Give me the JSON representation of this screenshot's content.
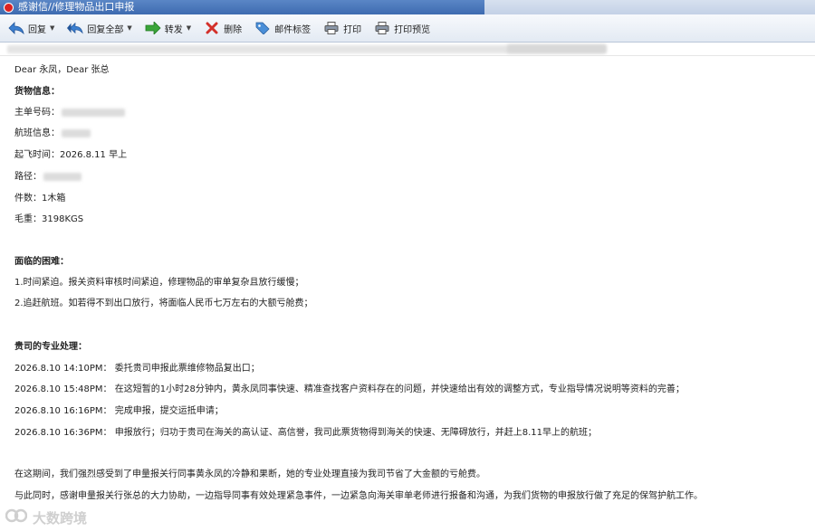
{
  "window": {
    "title": "感谢信//修理物品出口申报"
  },
  "toolbar": {
    "reply": "回复",
    "reply_all": "回复全部",
    "forward": "转发",
    "delete": "删除",
    "tag": "邮件标签",
    "print": "打印",
    "print_preview": "打印预览"
  },
  "email": {
    "greeting": "Dear 永凤，Dear 张总",
    "cargo_heading": "货物信息：",
    "main_no_label": "主单号码：",
    "flight_label": "航班信息：",
    "departure_label": "起飞时间：",
    "departure_value": "2026.8.11 早上",
    "route_label": "路径：",
    "pieces_label": "件数：",
    "pieces_value": "1木箱",
    "weight_label": "毛重：",
    "weight_value": "3198KGS",
    "difficulty_heading": "面临的困难：",
    "difficulties": [
      "1.时间紧迫。报关资料审核时间紧迫，修理物品的审单复杂且放行缓慢；",
      "2.追赶航班。如若得不到出口放行，将面临人民币七万左右的大额亏舱费；"
    ],
    "handling_heading": "贵司的专业处理：",
    "timeline": [
      "2026.8.10 14:10PM：  委托贵司申报此票维修物品复出口；",
      "2026.8.10 15:48PM：  在这短暂的1小时28分钟内，黄永凤同事快速、精准查找客户资料存在的问题，并快速给出有效的调整方式，专业指导情况说明等资料的完善；",
      "2026.8.10 16:16PM：  完成申报，提交运抵申请；",
      "2026.8.10 16:36PM：  申报放行；归功于贵司在海关的高认证、高信誉，我司此票货物得到海关的快速、无障碍放行，并赶上8.11早上的航班；"
    ],
    "closing_1": "在这期间，我们强烈感受到了申量报关行同事黄永凤的冷静和果断，她的专业处理直接为我司节省了大金额的亏舱费。",
    "closing_2": "与此同时，感谢申量报关行张总的大力协助，一边指导同事有效处理紧急事件，一边紧急向海关审单老师进行报备和沟通，为我们货物的申报放行做了充足的保驾护航工作。"
  },
  "watermark": {
    "text": "大数跨境"
  }
}
